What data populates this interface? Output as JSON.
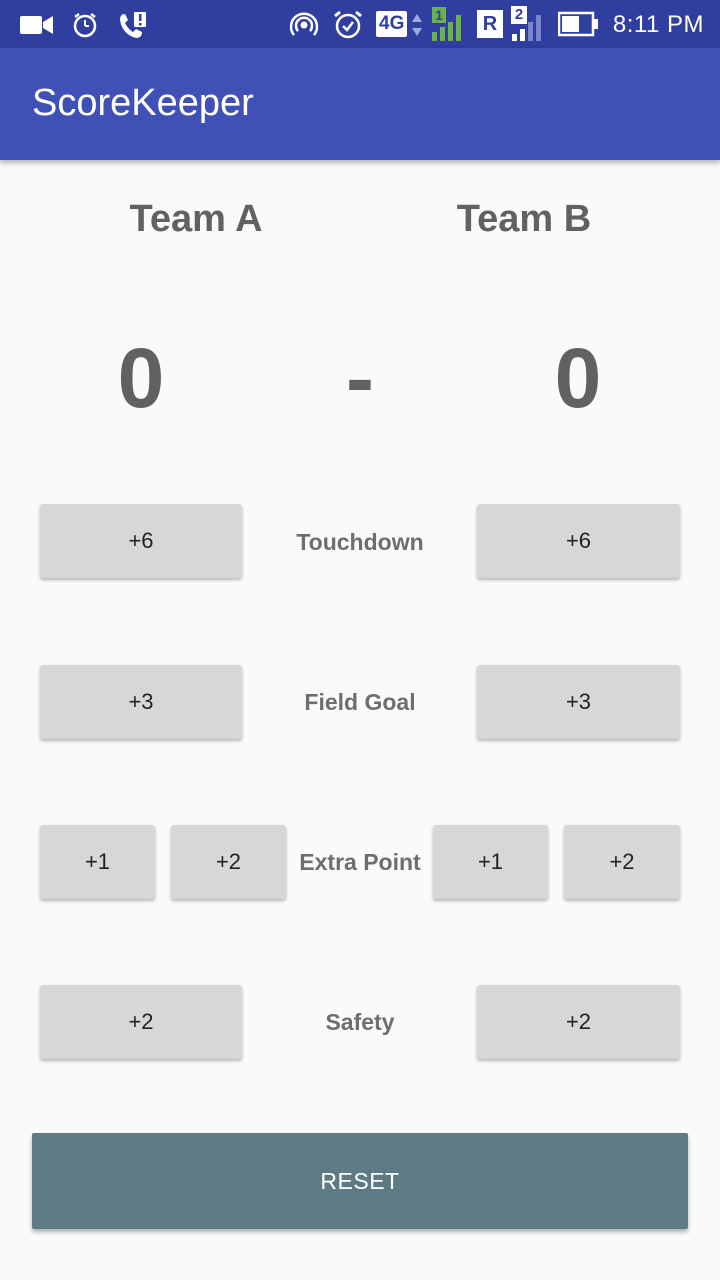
{
  "status_bar": {
    "time": "8:11 PM",
    "network_label": "4G",
    "sim1_badge": "1",
    "roaming_badge": "R",
    "sim2_badge": "2",
    "icons": [
      "video-camera-icon",
      "alarm-clock-icon",
      "call-alert-icon",
      "hotspot-icon",
      "alarm-icon",
      "signal-icon",
      "battery-icon"
    ]
  },
  "app_bar": {
    "title": "ScoreKeeper",
    "color": "#3f51b5"
  },
  "teams": {
    "a": {
      "name": "Team A",
      "score": "0"
    },
    "b": {
      "name": "Team B",
      "score": "0"
    },
    "separator": "-"
  },
  "rows": {
    "touchdown": {
      "label": "Touchdown",
      "a_btn": "+6",
      "b_btn": "+6"
    },
    "field_goal": {
      "label": "Field Goal",
      "a_btn": "+3",
      "b_btn": "+3"
    },
    "extra_point": {
      "label": "Extra Point",
      "a_btn1": "+1",
      "a_btn2": "+2",
      "b_btn1": "+1",
      "b_btn2": "+2"
    },
    "safety": {
      "label": "Safety",
      "a_btn": "+2",
      "b_btn": "+2"
    }
  },
  "reset": {
    "label": "RESET",
    "color": "#5e7b83"
  }
}
